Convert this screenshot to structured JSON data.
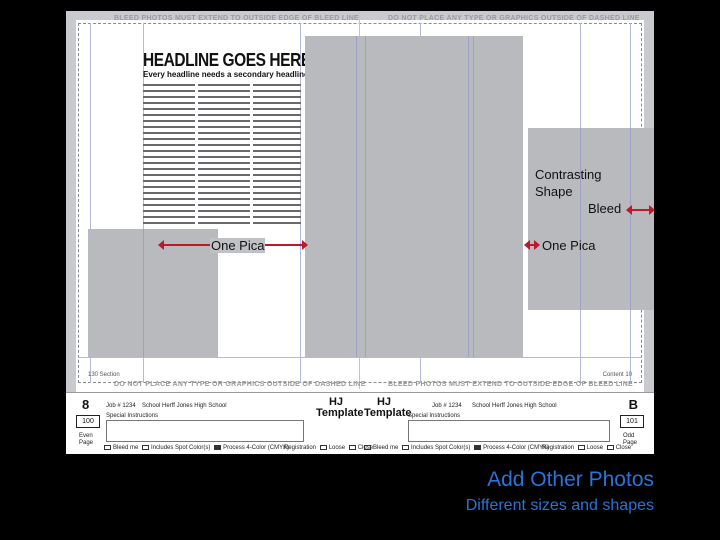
{
  "spread": {
    "top_warning_left": "BLEED PHOTOS MUST EXTEND TO OUTSIDE EDGE OF BLEED LINE",
    "top_warning_right": "DO NOT PLACE ANY TYPE OR GRAPHICS OUTSIDE OF DASHED LINE",
    "bottom_warning_left": "DO NOT PLACE ANY TYPE OR GRAPHICS OUTSIDE OF DASHED LINE",
    "bottom_warning_right": "BLEED PHOTOS MUST EXTEND TO OUTSIDE EDGE OF BLEED LINE",
    "headline": "HEADLINE GOES HERE",
    "subhead": "Every headline needs a secondary headline",
    "section_left": "130 Section",
    "section_right": "Content 10"
  },
  "footer": {
    "left_page_number": "8",
    "right_page_number": "B",
    "left_folio": "100",
    "right_folio": "101",
    "left_page_side": "Even Page",
    "right_page_side": "Odd Page",
    "job_left": "Job # 1234",
    "school_left": "School Herff Jones High School",
    "job_right": "Job # 1234",
    "school_right": "School Herff Jones High School",
    "special_instructions": "Special Instructions",
    "template_label": "HJ Template",
    "bleed_me": "Bleed me",
    "includes_spot": "Includes Spot Color(s)",
    "process_color": "Process 4-Color (CMYK)",
    "registration": "Registration",
    "loose": "Loose",
    "close": "Close"
  },
  "annotations": {
    "contrasting_shape": "Contrasting Shape",
    "bleed": "Bleed",
    "one_pica_left": "One Pica",
    "one_pica_right": "One Pica"
  },
  "slide": {
    "title": "Add Other Photos",
    "subtitle": "Different sizes and shapes"
  },
  "colors": {
    "accent_blue": "#2a73d8",
    "arrow_red": "#c0182b",
    "photo_gray": "#b9babd"
  }
}
